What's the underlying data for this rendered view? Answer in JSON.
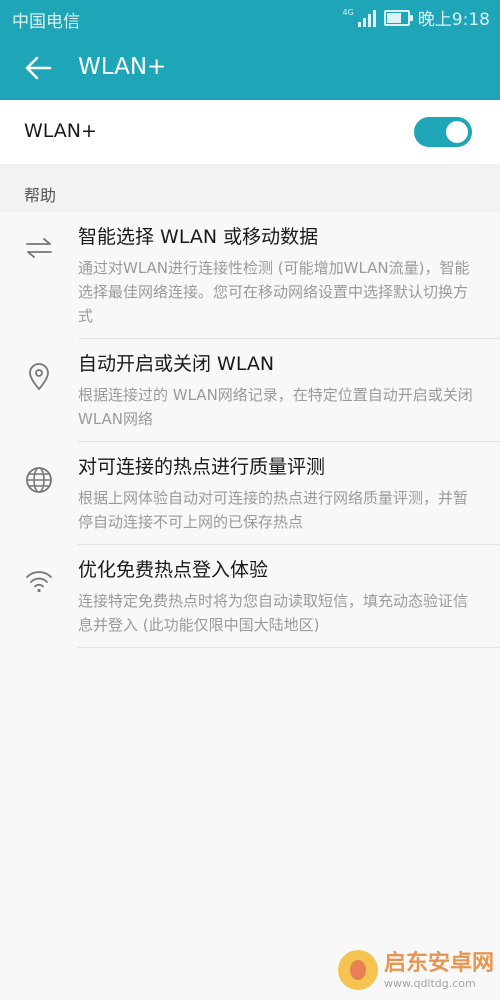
{
  "status_bar": {
    "carrier": "中国电信",
    "network_tag": "4G",
    "time": "晚上9:18",
    "battery_level": 0.75
  },
  "action_bar": {
    "title": "WLAN+",
    "back_icon": "arrow-left-icon"
  },
  "toggle": {
    "label": "WLAN+",
    "on": true
  },
  "section": {
    "header": "帮助"
  },
  "help_items": [
    {
      "icon": "switch-arrows-icon",
      "title": "智能选择 WLAN 或移动数据",
      "desc": "通过对WLAN进行连接性检测 (可能增加WLAN流量)，智能选择最佳网络连接。您可在移动网络设置中选择默认切换方式"
    },
    {
      "icon": "location-pin-icon",
      "title": "自动开启或关闭 WLAN",
      "desc": "根据连接过的 WLAN网络记录，在特定位置自动开启或关闭WLAN网络"
    },
    {
      "icon": "globe-icon",
      "title": "对可连接的热点进行质量评测",
      "desc": "根据上网体验自动对可连接的热点进行网络质量评测，并暂停自动连接不可上网的已保存热点"
    },
    {
      "icon": "wifi-icon",
      "title": "优化免费热点登入体验",
      "desc": "连接特定免费热点时将为您自动读取短信，填充动态验证信息并登入 (此功能仅限中国大陆地区)"
    }
  ],
  "watermark": {
    "name": "启东安卓网",
    "url": "www.qdltdg.com"
  },
  "colors": {
    "accent": "#1ea6b8",
    "text_primary": "#1a1a1a",
    "text_secondary": "#9a9a9a"
  }
}
